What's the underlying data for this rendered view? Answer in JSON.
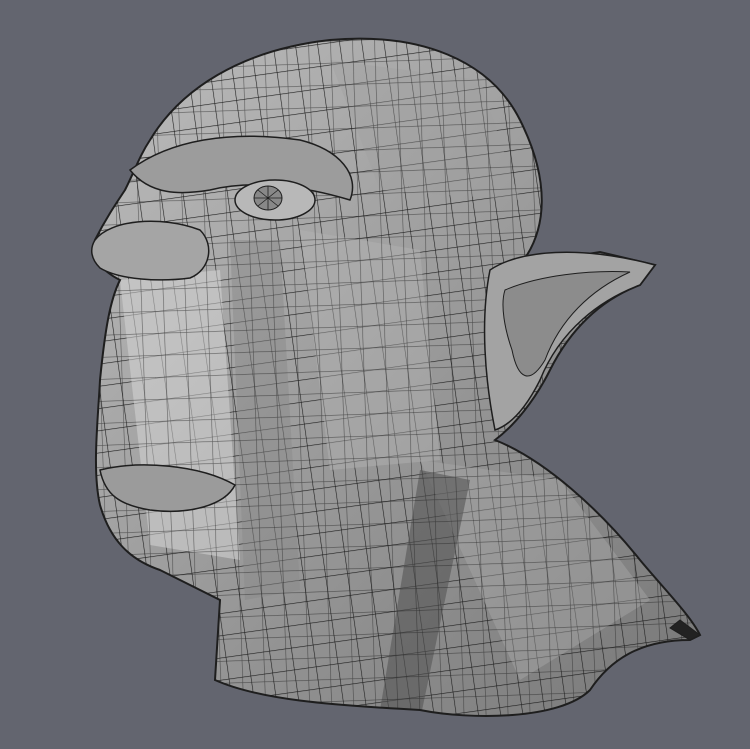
{
  "viewport": {
    "background_color": "#63656f",
    "mesh_fill_light": "#c9c9c9",
    "mesh_fill_mid": "#9d9d9d",
    "mesh_fill_dark": "#6e6e6e",
    "mesh_fill_shadow": "#4a4a4a",
    "wire_color": "#1e1e1e",
    "model_description_icon": "wireframe-head-icon"
  }
}
